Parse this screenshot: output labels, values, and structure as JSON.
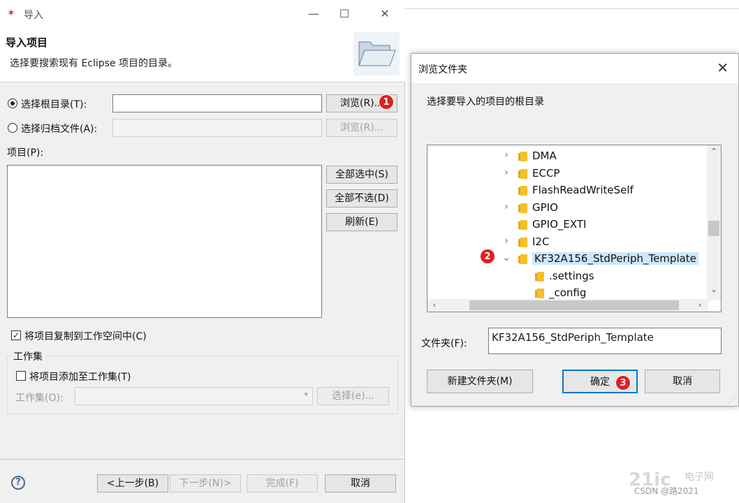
{
  "import_dialog": {
    "title": "导入",
    "header_title": "导入项目",
    "header_desc": "选择要搜索现有 Eclipse 项目的目录。",
    "root_dir_label": "选择根目录(T):",
    "root_dir_value": "",
    "archive_label": "选择归档文件(A):",
    "browse_label": "浏览(R)...",
    "browse_archive_label": "浏览(R)...",
    "projects_label": "项目(P):",
    "select_all_label": "全部选中(S)",
    "deselect_all_label": "全部不选(D)",
    "refresh_label": "刷新(E)",
    "copy_label": "将项目复制到工作空间中(C)",
    "working_set_group": "工作集",
    "add_to_ws_label": "将项目添加至工作集(T)",
    "ws_label": "工作集(O):",
    "select_ws_label": "选择(e)...",
    "back_label": "<上一步(B)",
    "next_label": "下一步(N)>",
    "finish_label": "完成(F)",
    "cancel_label": "取消"
  },
  "browse_dialog": {
    "title": "浏览文件夹",
    "prompt": "选择要导入的项目的根目录",
    "tree": [
      {
        "name": "DMA",
        "expandable": true,
        "level": 0
      },
      {
        "name": "ECCP",
        "expandable": true,
        "level": 0
      },
      {
        "name": "FlashReadWriteSelf",
        "expandable": false,
        "level": 0
      },
      {
        "name": "GPIO",
        "expandable": true,
        "level": 0
      },
      {
        "name": "GPIO_EXTI",
        "expandable": false,
        "level": 0
      },
      {
        "name": "I2C",
        "expandable": true,
        "level": 0
      },
      {
        "name": "KF32A156_StdPeriph_Template",
        "expandable": true,
        "expanded": true,
        "selected": true,
        "level": 0
      },
      {
        "name": ".settings",
        "expandable": false,
        "level": 1
      },
      {
        "name": "_config",
        "expandable": false,
        "level": 1
      }
    ],
    "folder_label": "文件夹(F):",
    "folder_value": "KF32A156_StdPeriph_Template",
    "new_folder_label": "新建文件夹(M)",
    "ok_label": "确定",
    "cancel_label": "取消"
  },
  "badges": {
    "one": "1",
    "two": "2",
    "three": "3"
  },
  "watermark": "21ic",
  "watermark_sub": "电子网",
  "watermark_credit": "CSDN @路2021",
  "colors": {
    "badge": "#e02020",
    "selection": "#cce8ff",
    "folder": "#f5c02a"
  }
}
